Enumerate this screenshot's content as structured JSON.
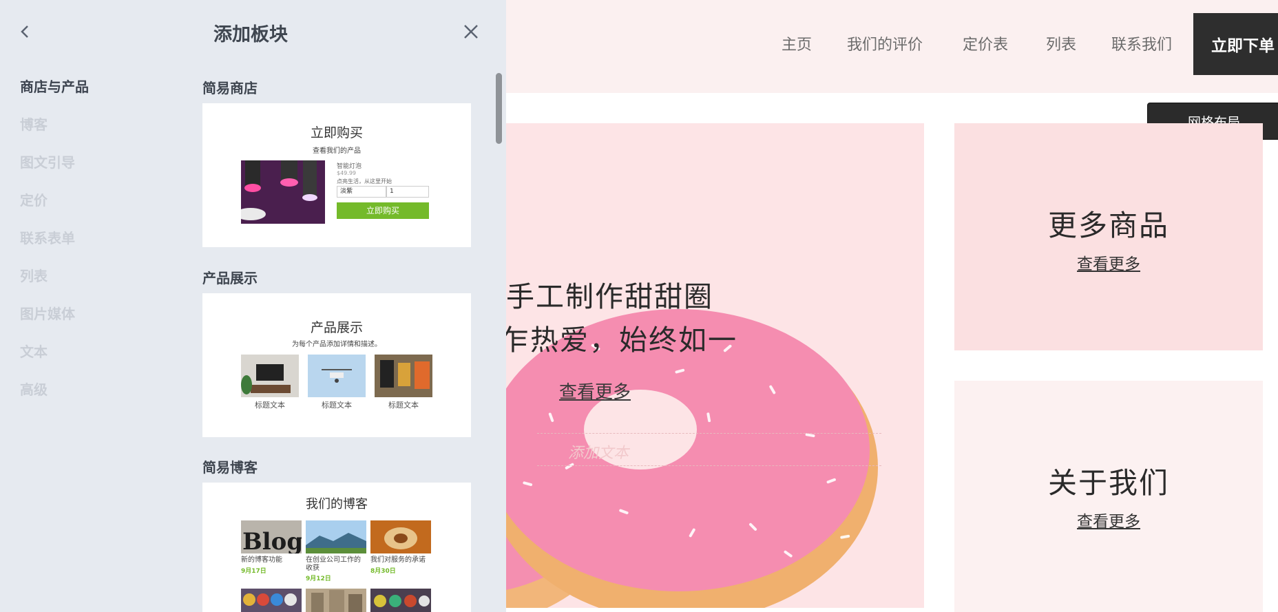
{
  "site": {
    "nav": [
      "主页",
      "我们的评价",
      "定价表",
      "列表",
      "联系我们"
    ],
    "order_button": "立即下单",
    "grid_button": "网格布局",
    "hero": {
      "line1": "手工制作甜甜圈",
      "line2": "乍热爱，始终如一",
      "link": "查看更多",
      "add_text_placeholder": "添加文本"
    },
    "tiles": [
      {
        "title": "更多商品",
        "link": "查看更多"
      },
      {
        "title": "关于我们",
        "link": "查看更多"
      }
    ]
  },
  "panel": {
    "title": "添加板块",
    "categories": [
      "商店与产品",
      "博客",
      "图文引导",
      "定价",
      "联系表单",
      "列表",
      "图片媒体",
      "文本",
      "高级"
    ],
    "active_category": "商店与产品",
    "sections": [
      {
        "title": "简易商店",
        "preview": {
          "heading": "立即购买",
          "subheading": "查看我们的产品",
          "product_name": "智能灯泡",
          "price": "$49.99",
          "description": "点亮生活，从这里开始",
          "variant": "淡紫",
          "quantity": "1",
          "button": "立即购买"
        }
      },
      {
        "title": "产品展示",
        "preview": {
          "heading": "产品展示",
          "subheading": "为每个产品添加详情和描述。",
          "captions": [
            "标题文本",
            "标题文本",
            "标题文本"
          ]
        }
      },
      {
        "title": "简易博客",
        "preview": {
          "heading": "我们的博客",
          "posts": [
            {
              "title": "新的博客功能",
              "date": "9月17日"
            },
            {
              "title": "在创业公司工作的收获",
              "date": "9月12日"
            },
            {
              "title": "我们对服务的承诺",
              "date": "8月30日"
            }
          ]
        }
      }
    ]
  },
  "colors": {
    "accent_green": "#74ba2a",
    "panel_bg": "#e6eaf0",
    "hero_bg": "#fde4e6",
    "dark_button": "#2e2e2e"
  }
}
